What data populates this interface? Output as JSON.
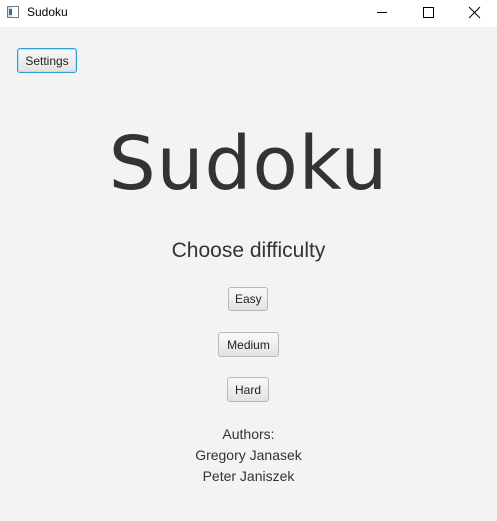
{
  "window": {
    "title": "Sudoku",
    "controls": {
      "minimize_icon": "minimize-icon",
      "maximize_icon": "maximize-icon",
      "close_icon": "close-icon"
    }
  },
  "toolbar": {
    "settings_label": "Settings"
  },
  "main": {
    "title": "Sudoku",
    "subtitle": "Choose difficulty",
    "difficulties": {
      "easy": "Easy",
      "medium": "Medium",
      "hard": "Hard"
    }
  },
  "authors": {
    "heading": "Authors:",
    "names": [
      "Gregory Janasek",
      "Peter Janiszek"
    ]
  },
  "colors": {
    "background": "#f3f3f3",
    "titlebar": "#ffffff",
    "text": "#333333",
    "focus_border": "#2e9fd6"
  }
}
